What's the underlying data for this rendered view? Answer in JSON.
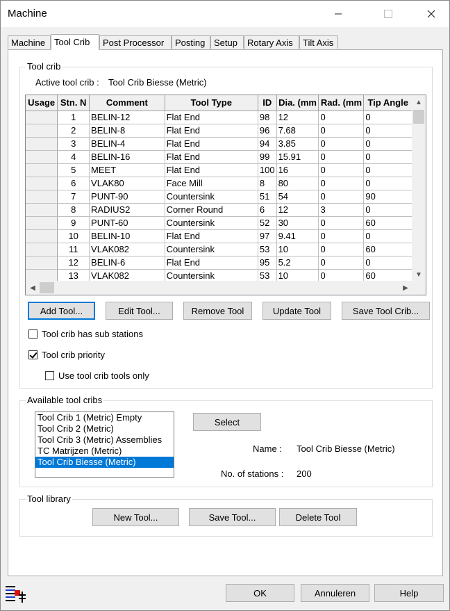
{
  "window": {
    "title": "Machine"
  },
  "tabs": [
    "Machine",
    "Tool Crib",
    "Post Processor",
    "Posting",
    "Setup",
    "Rotary Axis",
    "Tilt Axis"
  ],
  "tool_crib": {
    "group_label": "Tool crib",
    "active_label": "Active tool crib :",
    "active_value": "Tool Crib Biesse (Metric)",
    "columns": [
      "Usage",
      "Stn. N",
      "Comment",
      "Tool Type",
      "ID",
      "Dia. (mm",
      "Rad. (mm",
      "Tip Angle"
    ],
    "rows": [
      [
        "",
        "1",
        "BELIN-12",
        "Flat End",
        "98",
        "12",
        "0",
        "0"
      ],
      [
        "",
        "2",
        "BELIN-8",
        "Flat End",
        "96",
        "7.68",
        "0",
        "0"
      ],
      [
        "",
        "3",
        "BELIN-4",
        "Flat End",
        "94",
        "3.85",
        "0",
        "0"
      ],
      [
        "",
        "4",
        "BELIN-16",
        "Flat End",
        "99",
        "15.91",
        "0",
        "0"
      ],
      [
        "",
        "5",
        "MEET",
        "Flat End",
        "100",
        "16",
        "0",
        "0"
      ],
      [
        "",
        "6",
        "VLAK80",
        "Face Mill",
        "8",
        "80",
        "0",
        "0"
      ],
      [
        "",
        "7",
        "PUNT-90",
        "Countersink",
        "51",
        "54",
        "0",
        "90"
      ],
      [
        "",
        "8",
        "RADIUS2",
        "Corner Round",
        "6",
        "12",
        "3",
        "0"
      ],
      [
        "",
        "9",
        "PUNT-60",
        "Countersink",
        "52",
        "30",
        "0",
        "60"
      ],
      [
        "",
        "10",
        "BELIN-10",
        "Flat End",
        "97",
        "9.41",
        "0",
        "0"
      ],
      [
        "",
        "11",
        "VLAK082",
        "Countersink",
        "53",
        "10",
        "0",
        "60"
      ],
      [
        "",
        "12",
        "BELIN-6",
        "Flat End",
        "95",
        "5.2",
        "0",
        "0"
      ],
      [
        "",
        "13",
        "VLAK082",
        "Countersink",
        "53",
        "10",
        "0",
        "60"
      ]
    ],
    "buttons": {
      "add": "Add Tool...",
      "edit": "Edit Tool...",
      "remove": "Remove Tool",
      "update": "Update Tool",
      "save": "Save Tool Crib..."
    },
    "checkboxes": {
      "sub_stations": {
        "label": "Tool crib has sub stations",
        "checked": false
      },
      "priority": {
        "label": "Tool crib priority",
        "checked": true
      },
      "only": {
        "label": "Use tool crib tools only",
        "checked": false
      }
    }
  },
  "available": {
    "group_label": "Available tool cribs",
    "items": [
      "Tool Crib 1 (Metric) Empty",
      "Tool Crib 2 (Metric)",
      "Tool Crib 3 (Metric) Assemblies",
      "TC Matrijzen (Metric)",
      "Tool Crib Biesse (Metric)"
    ],
    "selected_index": 4,
    "select_button": "Select",
    "name_label": "Name :",
    "name_value": "Tool Crib Biesse (Metric)",
    "stations_label": "No. of stations :",
    "stations_value": "200"
  },
  "library": {
    "group_label": "Tool library",
    "new": "New Tool...",
    "save": "Save Tool...",
    "delete": "Delete Tool"
  },
  "footer": {
    "ok": "OK",
    "cancel": "Annuleren",
    "help": "Help"
  }
}
